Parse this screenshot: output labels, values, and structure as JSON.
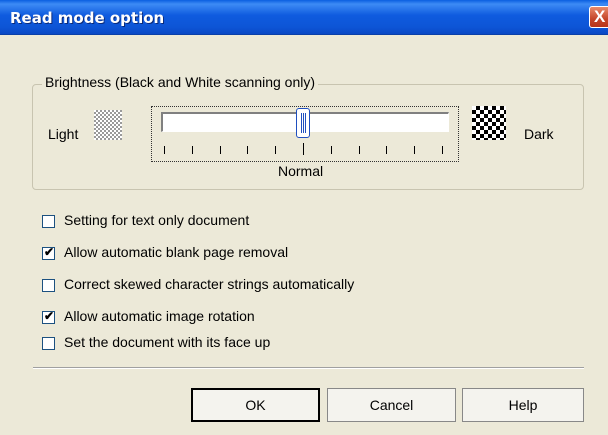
{
  "window": {
    "title": "Read mode option",
    "close_glyph": "X"
  },
  "brightness": {
    "group_label": "Brightness (Black and White scanning only)",
    "light_label": "Light",
    "dark_label": "Dark",
    "center_label": "Normal",
    "level": 0.5,
    "tick_count": 11,
    "light_icon": "light-pattern-icon",
    "dark_icon": "dark-pattern-icon"
  },
  "options": [
    {
      "label": "Setting for text only document",
      "checked": false
    },
    {
      "label": "Allow automatic blank page removal",
      "checked": true
    },
    {
      "label": "Correct skewed character strings automatically",
      "checked": false
    },
    {
      "label": "Allow automatic image rotation",
      "checked": true
    },
    {
      "label": "Set the document with its face up",
      "checked": false
    }
  ],
  "buttons": {
    "ok": "OK",
    "cancel": "Cancel",
    "help": "Help"
  },
  "colors": {
    "titlebar": "#0A5FE0",
    "dialog_bg": "#ECE9D8",
    "thumb_border": "#1F4FBF"
  }
}
